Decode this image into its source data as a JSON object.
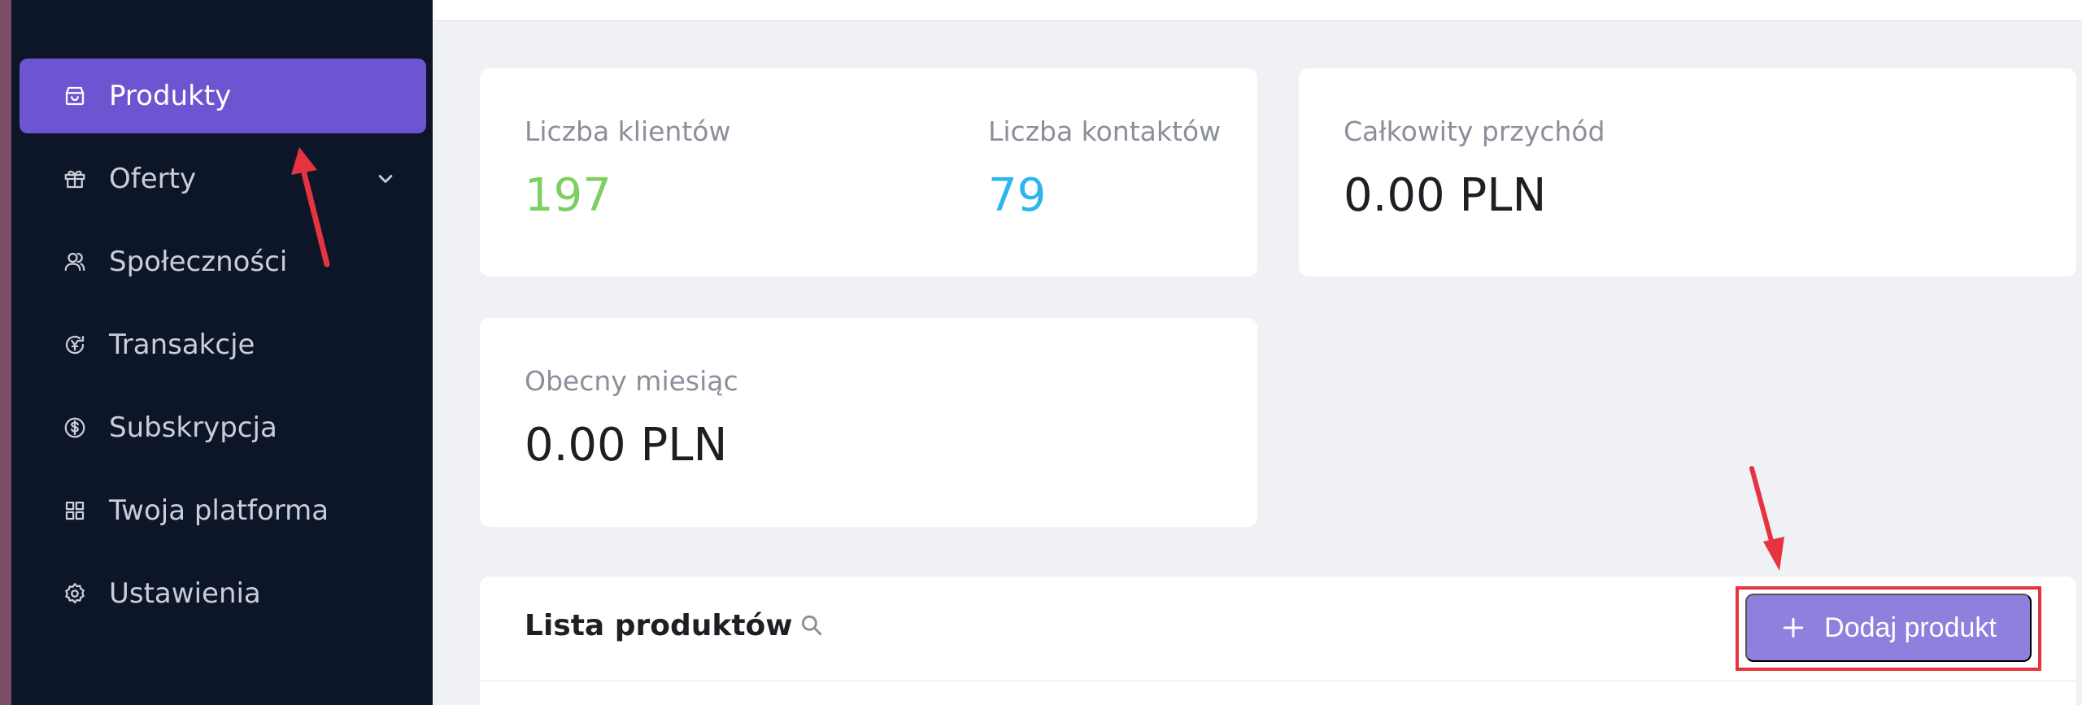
{
  "sidebar": {
    "items": [
      {
        "label": "Produkty",
        "icon": "bag-icon",
        "active": true
      },
      {
        "label": "Oferty",
        "icon": "gift-icon",
        "expandable": true
      },
      {
        "label": "Społeczności",
        "icon": "community-icon"
      },
      {
        "label": "Transakcje",
        "icon": "transactions-icon"
      },
      {
        "label": "Subskrypcja",
        "icon": "dollar-circle-icon"
      },
      {
        "label": "Twoja platforma",
        "icon": "grid-icon"
      },
      {
        "label": "Ustawienia",
        "icon": "gear-icon"
      }
    ]
  },
  "stats": {
    "clients_label": "Liczba klientów",
    "clients_value": "197",
    "contacts_label": "Liczba kontaktów",
    "contacts_value": "79",
    "revenue_label": "Całkowity przychód",
    "revenue_value": "0.00 PLN",
    "month_label": "Obecny miesiąc",
    "month_value": "0.00 PLN"
  },
  "product_list": {
    "title": "Lista produktów",
    "add_button": "Dodaj produkt"
  },
  "colors": {
    "sidebar_bg": "#0d1628",
    "active_item": "#6d55d2",
    "clients_green": "#7ccf63",
    "contacts_blue": "#2eb4ef",
    "button": "#8f80dd",
    "annotation_red": "#e53340"
  }
}
